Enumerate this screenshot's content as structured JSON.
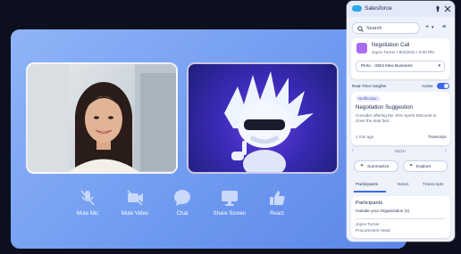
{
  "call": {
    "controls": [
      {
        "label": "Mute Mic",
        "icon": "mic-muted-icon"
      },
      {
        "label": "Mute Video",
        "icon": "video-muted-icon"
      },
      {
        "label": "Chat",
        "icon": "chat-bubble-icon"
      },
      {
        "label": "Share Screen",
        "icon": "monitor-icon"
      },
      {
        "label": "React",
        "icon": "thumbs-up-icon"
      }
    ]
  },
  "panel": {
    "title": "Salesforce",
    "search_placeholder": "Search",
    "meeting": {
      "title": "Negotiation Call",
      "subtitle": "Joyce Turner • 8/4/2024 • 3:00 PM"
    },
    "deal": "Pinto - 3304 New Business",
    "insights": {
      "header": "Real-Time Insights",
      "active_label": "Active",
      "tag": "Notification",
      "title": "Negotiation Suggestion",
      "body": "Consider offering the 15% Sprint Discount to close the deal fast.",
      "time": "1 min ago",
      "link": "Transcript",
      "pager": "01/10"
    },
    "buttons": {
      "summarize": "Summarize",
      "explore": "Explore"
    },
    "tabs": [
      "Participants",
      "Notes",
      "Transcripts"
    ],
    "participants": {
      "heading": "Participants",
      "org": "Outside your Organization (1)",
      "name": "Joyce Turner",
      "role": "Procurement Head"
    },
    "colors": {
      "accent": "#6c63ff",
      "brand": "#2aa8e8"
    }
  }
}
